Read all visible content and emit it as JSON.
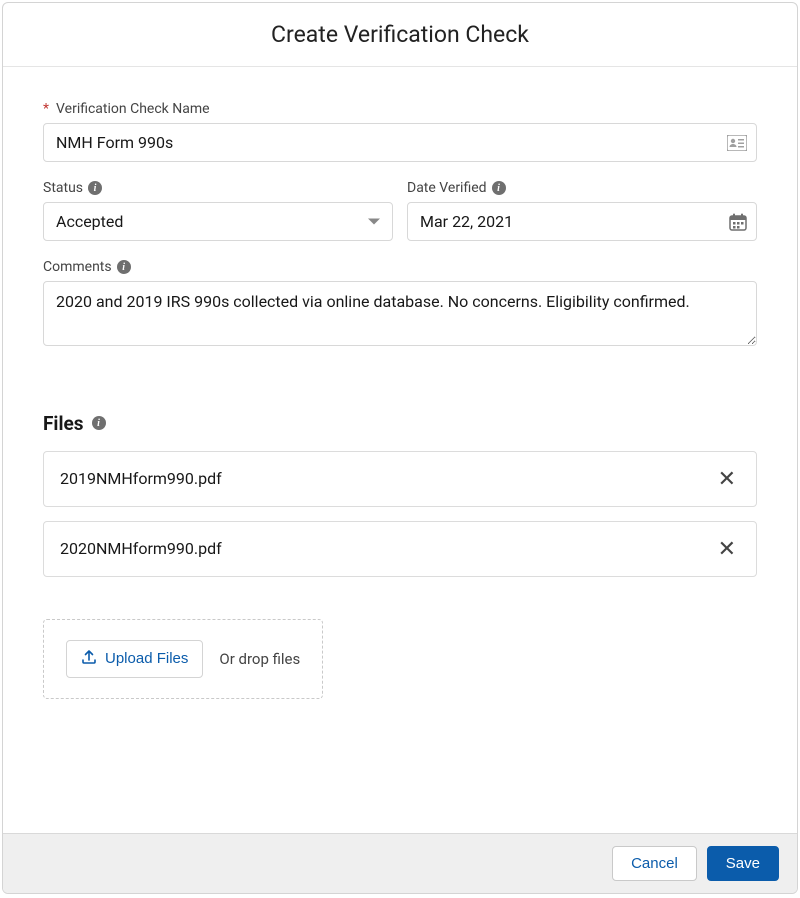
{
  "header": {
    "title": "Create Verification Check"
  },
  "fields": {
    "name_label": "Verification Check Name",
    "name_value": "NMH Form 990s",
    "status_label": "Status",
    "status_value": "Accepted",
    "date_label": "Date Verified",
    "date_value": "Mar 22, 2021",
    "comments_label": "Comments",
    "comments_value": "2020 and 2019 IRS 990s collected via online database. No concerns. Eligibility confirmed."
  },
  "files": {
    "section_title": "Files",
    "items": [
      {
        "name": "2019NMHform990.pdf"
      },
      {
        "name": "2020NMHform990.pdf"
      }
    ],
    "upload_label": "Upload Files",
    "drop_text": "Or drop files"
  },
  "footer": {
    "cancel": "Cancel",
    "save": "Save"
  },
  "icons": {
    "info": "i",
    "close": "✕"
  }
}
